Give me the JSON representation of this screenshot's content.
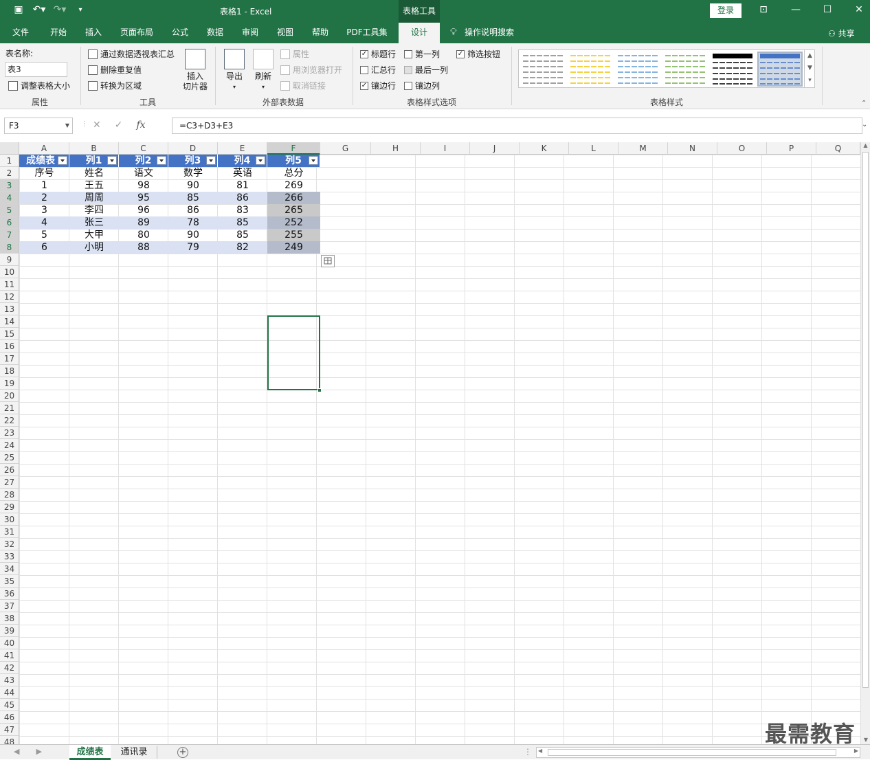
{
  "titlebar": {
    "title": "表格1 - Excel",
    "tool_tab": "表格工具",
    "login": "登录",
    "qat": {
      "save": "save-icon",
      "undo": "undo-icon",
      "redo": "redo-icon",
      "more": "customize-icon"
    }
  },
  "tabs": [
    {
      "label": "文件"
    },
    {
      "label": "开始"
    },
    {
      "label": "插入"
    },
    {
      "label": "页面布局"
    },
    {
      "label": "公式"
    },
    {
      "label": "数据"
    },
    {
      "label": "审阅"
    },
    {
      "label": "视图"
    },
    {
      "label": "帮助"
    },
    {
      "label": "PDF工具集"
    },
    {
      "label": "设计"
    }
  ],
  "tell_me": "操作说明搜索",
  "share": "共享",
  "ribbon": {
    "properties": {
      "table_name_label": "表名称:",
      "table_name_value": "表3",
      "resize": "调整表格大小",
      "group": "属性"
    },
    "tools": {
      "pivot": "通过数据透视表汇总",
      "remove_dup": "删除重复值",
      "convert": "转换为区域",
      "slicer": "插入切片器",
      "slicer_line1": "插入",
      "slicer_line2": "切片器",
      "group": "工具"
    },
    "external": {
      "export": "导出",
      "refresh": "刷新",
      "properties": "属性",
      "open_browser": "用浏览器打开",
      "unlink": "取消链接",
      "group": "外部表数据"
    },
    "style_options": {
      "header_row": "标题行",
      "first_column": "第一列",
      "filter_button": "筛选按钮",
      "total_row": "汇总行",
      "last_column": "最后一列",
      "banded_rows": "镶边行",
      "banded_columns": "镶边列",
      "group": "表格样式选项",
      "checked": {
        "header_row": true,
        "first_column": false,
        "filter_button": true,
        "total_row": false,
        "last_column": false,
        "banded_rows": true,
        "banded_columns": false
      }
    },
    "styles": {
      "group": "表格样式",
      "swatch_colors": [
        "#808080",
        "#f2c400",
        "#5b9bd5",
        "#70ad47",
        "#000000",
        "#4472c4"
      ]
    }
  },
  "formula_bar": {
    "name_box": "F3",
    "formula": "=C3+D3+E3"
  },
  "columns": [
    "A",
    "B",
    "C",
    "D",
    "E",
    "F",
    "G",
    "H",
    "I",
    "J",
    "K",
    "L",
    "M",
    "N",
    "O",
    "P",
    "Q"
  ],
  "rows_count": 48,
  "table": {
    "header": [
      "成绩表",
      "列1",
      "列2",
      "列3",
      "列4",
      "列5"
    ],
    "subheader": [
      "序号",
      "姓名",
      "语文",
      "数学",
      "英语",
      "总分"
    ],
    "rows": [
      [
        "1",
        "王五",
        "98",
        "90",
        "81",
        "269"
      ],
      [
        "2",
        "周周",
        "95",
        "85",
        "86",
        "266"
      ],
      [
        "3",
        "李四",
        "96",
        "86",
        "83",
        "265"
      ],
      [
        "4",
        "张三",
        "89",
        "78",
        "85",
        "252"
      ],
      [
        "5",
        "大甲",
        "80",
        "90",
        "85",
        "255"
      ],
      [
        "6",
        "小明",
        "88",
        "79",
        "82",
        "249"
      ]
    ],
    "header_color": "#4472c4",
    "band_color": "#d9e1f2"
  },
  "selection": {
    "range": "F3:F8",
    "color": "#217346"
  },
  "sheets": [
    {
      "label": "成绩表",
      "active": true
    },
    {
      "label": "通讯录",
      "active": false
    }
  ],
  "watermark": "最需教育"
}
